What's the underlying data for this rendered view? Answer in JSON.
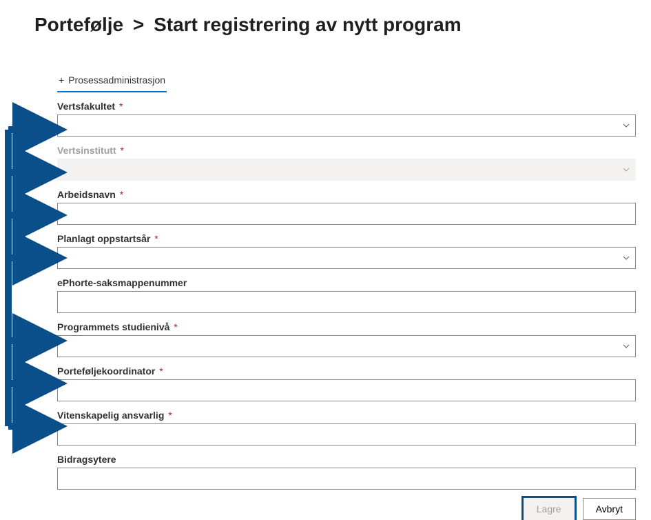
{
  "breadcrumb": {
    "root": "Portefølje",
    "sep": ">",
    "leaf": "Start registrering av nytt program"
  },
  "tab": {
    "plus": "+",
    "label": "Prosessadministrasjon"
  },
  "fields": {
    "vertsfakultet": {
      "label": "Vertsfakultet",
      "value": ""
    },
    "vertsinstitutt": {
      "label": "Vertsinstitutt",
      "value": ""
    },
    "arbeidsnavn": {
      "label": "Arbeidsnavn",
      "value": ""
    },
    "planlagt_oppstartsaar": {
      "label": "Planlagt oppstartsår",
      "value": ""
    },
    "ephorte": {
      "label": "ePhorte-saksmappenummer",
      "value": ""
    },
    "studienivaa": {
      "label": "Programmets studienivå",
      "value": ""
    },
    "koordinator": {
      "label": "Porteføljekoordinator",
      "value": ""
    },
    "vitenskapelig": {
      "label": "Vitenskapelig ansvarlig",
      "value": ""
    },
    "bidragsytere": {
      "label": "Bidragsytere",
      "value": ""
    }
  },
  "required_marker": "*",
  "buttons": {
    "save": "Lagre",
    "cancel": "Avbryt"
  }
}
